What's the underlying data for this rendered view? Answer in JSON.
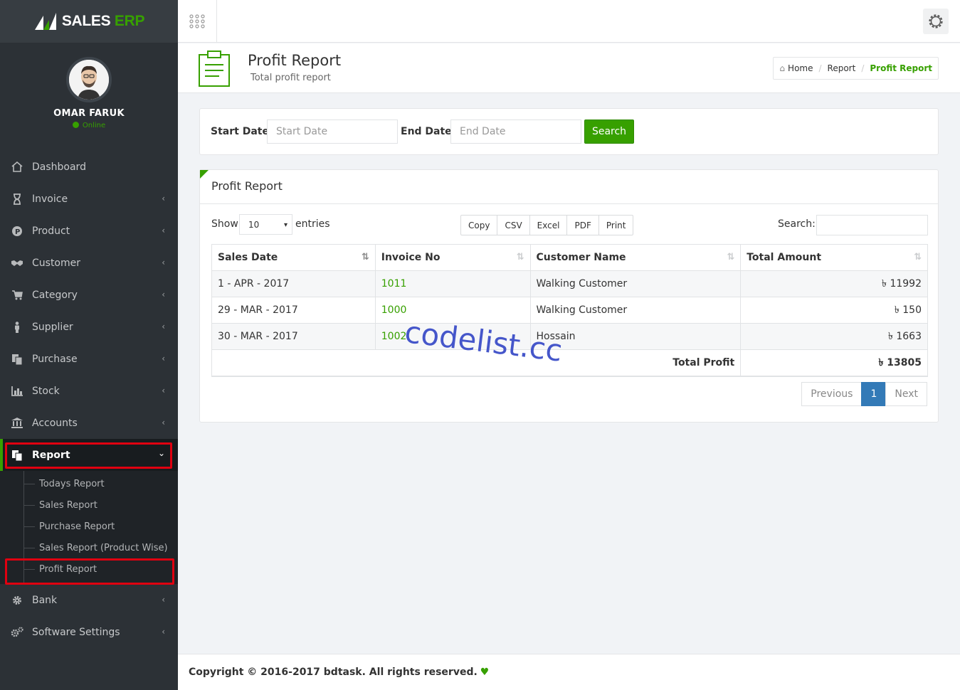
{
  "brand": {
    "name_a": "SALES ",
    "name_b": "ERP"
  },
  "user": {
    "name": "OMAR FARUK",
    "status": "Online"
  },
  "menu": [
    {
      "label": "Dashboard",
      "icon": "home-icon"
    },
    {
      "label": "Invoice",
      "icon": "hourglass-icon"
    },
    {
      "label": "Product",
      "icon": "product-icon"
    },
    {
      "label": "Customer",
      "icon": "handshake-icon"
    },
    {
      "label": "Category",
      "icon": "cart-icon"
    },
    {
      "label": "Supplier",
      "icon": "person-icon"
    },
    {
      "label": "Purchase",
      "icon": "documents-icon"
    },
    {
      "label": "Stock",
      "icon": "bar-chart-icon"
    },
    {
      "label": "Accounts",
      "icon": "bank-icon"
    },
    {
      "label": "Report",
      "icon": "documents-icon"
    },
    {
      "label": "Bank",
      "icon": "gear-icon"
    },
    {
      "label": "Software Settings",
      "icon": "gears-icon"
    }
  ],
  "report_submenu": [
    "Todays Report",
    "Sales Report",
    "Purchase Report",
    "Sales Report (Product Wise)",
    "Profit Report"
  ],
  "page": {
    "title": "Profit Report",
    "subtitle": "Total profit report"
  },
  "breadcrumb": {
    "home": "Home",
    "parent": "Report",
    "current": "Profit Report",
    "sep": "/"
  },
  "filter": {
    "start_label": "Start Date:",
    "start_placeholder": "Start Date",
    "end_label": "End Date:",
    "end_placeholder": "End Date",
    "search_button": "Search"
  },
  "report": {
    "title": "Profit Report",
    "show_label": "Show",
    "entries_value": "10",
    "entries_label": "entries",
    "export_buttons": [
      "Copy",
      "CSV",
      "Excel",
      "PDF",
      "Print"
    ],
    "search_label": "Search:",
    "columns": [
      "Sales Date",
      "Invoice No",
      "Customer Name",
      "Total Amount"
    ],
    "rows": [
      {
        "date": "1 - APR - 2017",
        "invoice": "1011",
        "customer": "Walking Customer",
        "amount": "৳ 11992"
      },
      {
        "date": "29 - MAR - 2017",
        "invoice": "1000",
        "customer": "Walking Customer",
        "amount": "৳ 150"
      },
      {
        "date": "30 - MAR - 2017",
        "invoice": "1002",
        "customer": "Hossain",
        "amount": "৳ 1663"
      }
    ],
    "total_label": "Total Profit",
    "total_value": "৳ 13805",
    "pagination": {
      "prev": "Previous",
      "page": "1",
      "next": "Next"
    }
  },
  "watermark": "codelist.cc",
  "footer": {
    "text": "Copyright © 2016-2017 bdtask. All rights reserved.",
    "heart": "♥"
  },
  "colors": {
    "accent": "#37a000",
    "sidebar": "#2c3136",
    "highlight": "#e00010",
    "page_active": "#337ab7"
  }
}
